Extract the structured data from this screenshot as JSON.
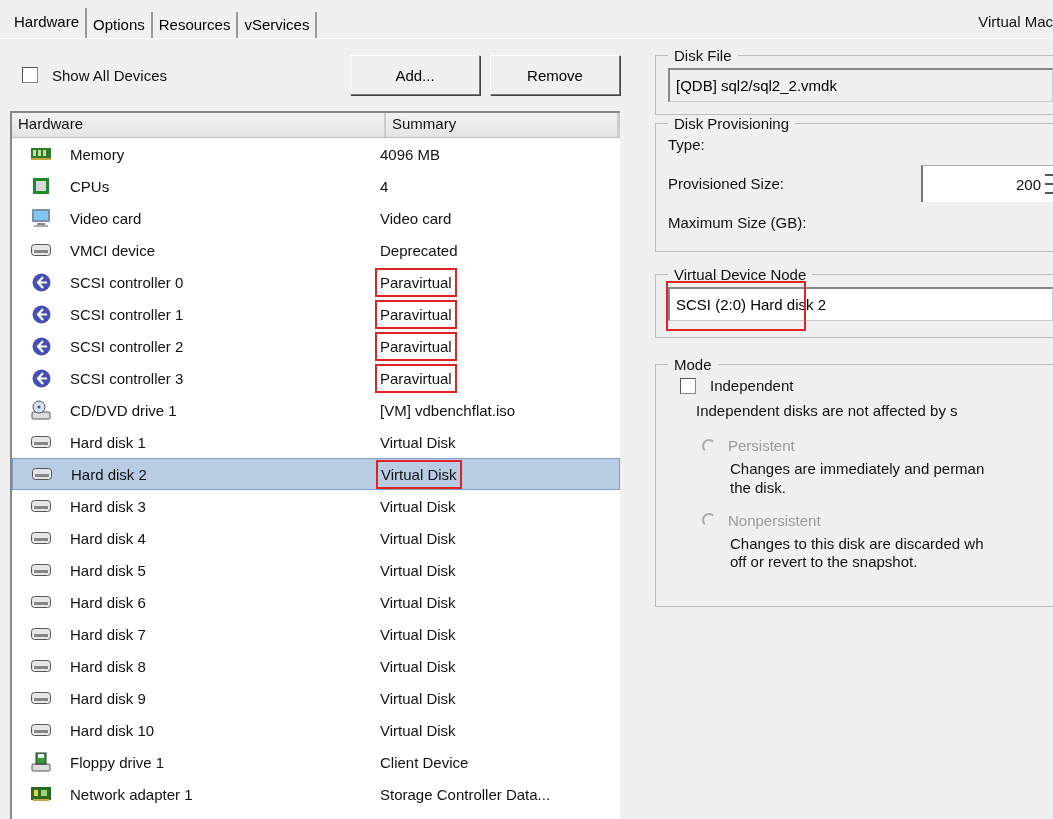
{
  "tabs": [
    {
      "label": "Hardware",
      "selected": true
    },
    {
      "label": "Options",
      "selected": false
    },
    {
      "label": "Resources",
      "selected": false
    },
    {
      "label": "vServices",
      "selected": false
    }
  ],
  "window_title": "Virtual Mac",
  "show_all_devices": {
    "label": "Show All Devices",
    "checked": false
  },
  "buttons": [
    "Add...",
    "Remove"
  ],
  "table": {
    "columns": [
      "Hardware",
      "Summary"
    ],
    "rows": [
      {
        "kind": "memory",
        "name": "Memory",
        "summary": "4096 MB",
        "selected": false,
        "highlighted": false
      },
      {
        "kind": "cpu",
        "name": "CPUs",
        "summary": "4",
        "selected": false,
        "highlighted": false
      },
      {
        "kind": "video",
        "name": "Video card",
        "summary": "Video card",
        "selected": false,
        "highlighted": false
      },
      {
        "kind": "disk",
        "name": "VMCI device",
        "summary": "Deprecated",
        "selected": false,
        "highlighted": false
      },
      {
        "kind": "scsi",
        "name": "SCSI controller 0",
        "summary": "Paravirtual",
        "selected": false,
        "highlighted": true
      },
      {
        "kind": "scsi",
        "name": "SCSI controller 1",
        "summary": "Paravirtual",
        "selected": false,
        "highlighted": true
      },
      {
        "kind": "scsi",
        "name": "SCSI controller 2",
        "summary": "Paravirtual",
        "selected": false,
        "highlighted": true
      },
      {
        "kind": "scsi",
        "name": "SCSI controller 3",
        "summary": "Paravirtual",
        "selected": false,
        "highlighted": true
      },
      {
        "kind": "cdrom",
        "name": "CD/DVD drive 1",
        "summary": "[VM] vdbenchflat.iso",
        "selected": false,
        "highlighted": false
      },
      {
        "kind": "disk",
        "name": "Hard disk 1",
        "summary": "Virtual Disk",
        "selected": false,
        "highlighted": false
      },
      {
        "kind": "disk",
        "name": "Hard disk 2",
        "summary": "Virtual Disk",
        "selected": true,
        "highlighted": true
      },
      {
        "kind": "disk",
        "name": "Hard disk 3",
        "summary": "Virtual Disk",
        "selected": false,
        "highlighted": false
      },
      {
        "kind": "disk",
        "name": "Hard disk 4",
        "summary": "Virtual Disk",
        "selected": false,
        "highlighted": false
      },
      {
        "kind": "disk",
        "name": "Hard disk 5",
        "summary": "Virtual Disk",
        "selected": false,
        "highlighted": false
      },
      {
        "kind": "disk",
        "name": "Hard disk 6",
        "summary": "Virtual Disk",
        "selected": false,
        "highlighted": false
      },
      {
        "kind": "disk",
        "name": "Hard disk 7",
        "summary": "Virtual Disk",
        "selected": false,
        "highlighted": false
      },
      {
        "kind": "disk",
        "name": "Hard disk 8",
        "summary": "Virtual Disk",
        "selected": false,
        "highlighted": false
      },
      {
        "kind": "disk",
        "name": "Hard disk 9",
        "summary": "Virtual Disk",
        "selected": false,
        "highlighted": false
      },
      {
        "kind": "disk",
        "name": "Hard disk 10",
        "summary": "Virtual Disk",
        "selected": false,
        "highlighted": false
      },
      {
        "kind": "floppy",
        "name": "Floppy drive 1",
        "summary": "Client Device",
        "selected": false,
        "highlighted": false
      },
      {
        "kind": "network",
        "name": "Network adapter 1",
        "summary": "Storage Controller Data...",
        "selected": false,
        "highlighted": false
      }
    ]
  },
  "disk_file": {
    "title": "Disk File",
    "value": "[QDB] sql2/sql2_2.vmdk"
  },
  "disk_provisioning": {
    "title": "Disk Provisioning",
    "type_label": "Type:",
    "provisioned_label": "Provisioned Size:",
    "provisioned_value": "200",
    "max_label": "Maximum Size (GB):"
  },
  "virtual_device_node": {
    "title": "Virtual Device Node",
    "value": "SCSI (2:0) Hard disk 2",
    "highlighted": true
  },
  "mode": {
    "title": "Mode",
    "independent": {
      "label": "Independent",
      "checked": false
    },
    "description": "Independent disks are not affected by s",
    "options": [
      {
        "label": "Persistent",
        "selected": false,
        "disabled": true,
        "description": "Changes are immediately and perman\nthe disk."
      },
      {
        "label": "Nonpersistent",
        "selected": false,
        "disabled": true,
        "description": "Changes to this disk are discarded wh\noff or revert to the snapshot."
      }
    ]
  }
}
